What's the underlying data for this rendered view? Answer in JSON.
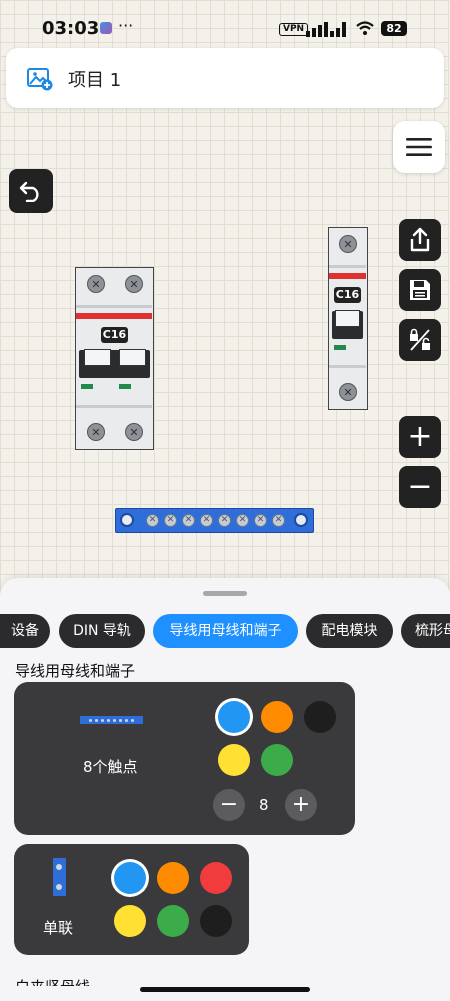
{
  "status_bar": {
    "time": "03:03",
    "more": "···",
    "vpn": "VPN",
    "battery": "82"
  },
  "header": {
    "title": "项目 1",
    "icon": "image-add-icon"
  },
  "toolbar": {
    "menu_icon": "hamburger-menu-icon",
    "undo_icon": "undo-icon",
    "share_icon": "share-icon",
    "save_icon": "save-icon",
    "lock_icon": "lock-toggle-icon",
    "zoom_in_label": "+",
    "zoom_out_label": "−"
  },
  "canvas": {
    "breaker_double": {
      "rating": "C16"
    },
    "breaker_single": {
      "rating": "C16"
    }
  },
  "sheet": {
    "tabs": [
      {
        "label": "设备"
      },
      {
        "label": "DIN 导轨"
      },
      {
        "label": "导线用母线和端子",
        "active": true
      },
      {
        "label": "配电模块"
      },
      {
        "label": "梳形母"
      }
    ],
    "section_title": "导线用母线和端子",
    "busbar_card": {
      "caption": "8个触点",
      "count": "8",
      "minus_label": "−",
      "plus_label": "+",
      "colors": [
        "#2196f3",
        "#ff8c00",
        "#1e1e1e",
        "#ffe033",
        "#3cab4a"
      ],
      "selected_color": "#2196f3"
    },
    "terminal_card": {
      "caption": "单联",
      "colors": [
        "#2196f3",
        "#ff8c00",
        "#f03c3c",
        "#ffe033",
        "#3cab4a",
        "#1e1e1e"
      ],
      "selected_color": "#2196f3"
    },
    "next_section_title": "白夹竖母线"
  },
  "colors": {
    "accent": "#1e90ff",
    "dark_button": "#222222",
    "card": "#3a3a3c"
  }
}
